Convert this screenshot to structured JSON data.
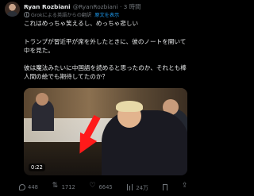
{
  "author": {
    "name": "Ryan Rozbiani",
    "handle": "@RyanRozbiani · 3 時間"
  },
  "translation": {
    "note": "Grokによる英語からの翻訳",
    "original_link": "原文を表示"
  },
  "tweet": {
    "line1": "これはめっちゃ笑えるし、めっちゃ悲しい",
    "line2": "トランプが習近平が席を外したときに、彼のノートを開いて中を見た。",
    "line3": "彼は魔法みたいに中国語を読めると思ったのか、それとも棒人間の絵でも期待してたのか？"
  },
  "media": {
    "duration": "0:22"
  },
  "actions": {
    "replies": "448",
    "reposts": "1712",
    "likes": "6645",
    "views": "24万"
  }
}
